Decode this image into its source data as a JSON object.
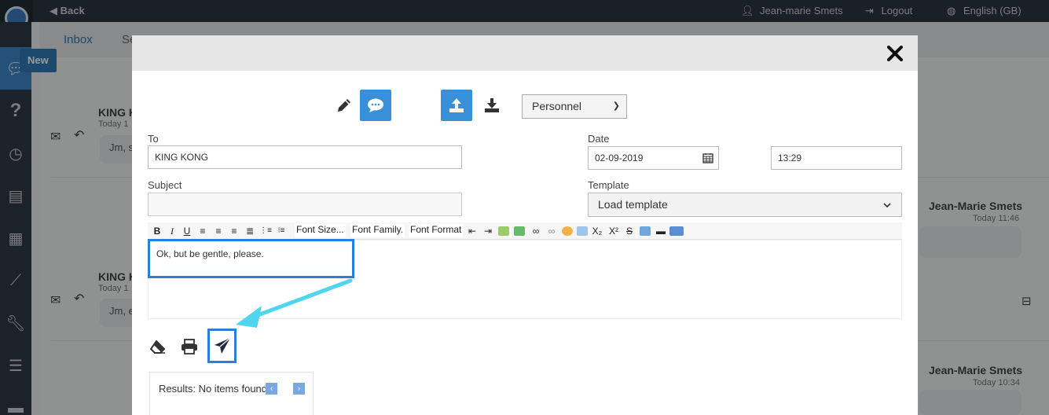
{
  "topbar": {
    "back_label": "Back",
    "user_name": "Jean-marie Smets",
    "logout_label": "Logout",
    "language_label": "English (GB)"
  },
  "tabs": [
    {
      "label": "Inbox"
    },
    {
      "label": "Se"
    }
  ],
  "new_button_label": "New",
  "messages": [
    {
      "sender": "KING K",
      "time": "Today 1",
      "preview": "Jm, s"
    },
    {
      "sender": "KING K",
      "time": "Today 1",
      "preview": "Jm, e"
    }
  ],
  "replies": [
    {
      "sender": "Jean-Marie Smets",
      "time": "Today 11:46"
    },
    {
      "sender": "Jean-Marie Smets",
      "time": "Today 10:34"
    }
  ],
  "modal": {
    "close_label": "✕",
    "folder_select": {
      "value": "Personnel"
    },
    "to": {
      "label": "To",
      "value": "KING KONG"
    },
    "date": {
      "label": "Date",
      "value": "02-09-2019"
    },
    "time": {
      "value": "13:29"
    },
    "subject": {
      "label": "Subject",
      "value": ""
    },
    "template": {
      "label": "Template",
      "value": "Load template"
    },
    "editor_toolbar": {
      "bold": "B",
      "italic": "I",
      "underline": "U",
      "font_size_label": "Font Size...",
      "font_family_label": "Font Family.",
      "font_format_label": "Font Format",
      "subscript": "X₂",
      "superscript": "X²",
      "strike": "S"
    },
    "body_text": "Ok, but be gentle, please.",
    "results": {
      "text": "Results: No items found.",
      "prev": "‹",
      "next": "›"
    }
  },
  "colors": {
    "accent": "#3a8fd9",
    "highlight": "#2b7fd9",
    "annotation_arrow": "#4fd5f0",
    "topbar": "#2b3641"
  }
}
